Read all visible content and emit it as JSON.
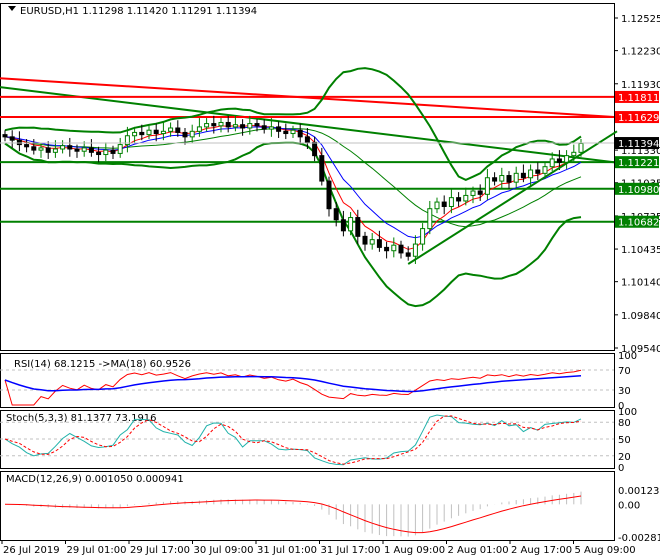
{
  "header": {
    "symbol": "EURUSD,H1",
    "ohlc": "1.11298 1.11420 1.11291 1.11394"
  },
  "chart_data": {
    "type": "candlestick",
    "title": "EURUSD,H1",
    "price_ticks": [
      "1.12525",
      "1.12230",
      "1.11930",
      "1.11330",
      "1.11035",
      "1.10735",
      "1.10435",
      "1.10140",
      "1.09840",
      "1.09540"
    ],
    "price_range": [
      1.0954,
      1.12525
    ],
    "closes": [
      1.1145,
      1.1142,
      1.1138,
      1.1136,
      1.1133,
      1.1135,
      1.1131,
      1.1134,
      1.1137,
      1.1134,
      1.1132,
      1.1135,
      1.1131,
      1.1129,
      1.1133,
      1.113,
      1.1138,
      1.1146,
      1.1149,
      1.1147,
      1.1151,
      1.1148,
      1.115,
      1.1153,
      1.1149,
      1.1145,
      1.115,
      1.1154,
      1.1157,
      1.1155,
      1.1158,
      1.1154,
      1.1156,
      1.1153,
      1.1157,
      1.1155,
      1.1152,
      1.1154,
      1.115,
      1.1148,
      1.1151,
      1.1145,
      1.114,
      1.1128,
      1.1105,
      1.108,
      1.107,
      1.106,
      1.1072,
      1.1055,
      1.1048,
      1.1052,
      1.1045,
      1.1042,
      1.1047,
      1.104,
      1.1037,
      1.1048,
      1.1062,
      1.108,
      1.1086,
      1.1082,
      1.109,
      1.1087,
      1.1092,
      1.1096,
      1.1093,
      1.1108,
      1.1105,
      1.111,
      1.1104,
      1.1112,
      1.1108,
      1.1115,
      1.1112,
      1.1118,
      1.1125,
      1.1122,
      1.1128,
      1.1131,
      1.1139
    ],
    "current_price": {
      "label": "1.11394",
      "value": 1.11394
    },
    "levels": [
      {
        "label": "1.11811",
        "value": 1.11811,
        "color": "#ff0000"
      },
      {
        "label": "1.11629",
        "value": 1.11629,
        "color": "#ff0000"
      },
      {
        "label": "1.11221",
        "value": 1.11221,
        "color": "#008000"
      },
      {
        "label": "1.10980",
        "value": 1.1098,
        "color": "#008000"
      },
      {
        "label": "1.10682",
        "value": 1.10682,
        "color": "#008000"
      }
    ],
    "slow_ma_red": [
      1.1198,
      1.1163
    ],
    "slow_ma_green": [
      1.119,
      1.1122
    ],
    "trendline": {
      "from_bar": 56,
      "from": 1.103,
      "to_bar": 85,
      "to": 1.115
    },
    "time_labels": [
      "26 Jul 2019",
      "29 Jul 01:00",
      "29 Jul 17:00",
      "30 Jul 09:00",
      "31 Jul 01:00",
      "31 Jul 17:00",
      "1 Aug 09:00",
      "2 Aug 01:00",
      "2 Aug 17:00",
      "5 Aug 09:00"
    ],
    "rsi": {
      "label": "RSI(14) 68.1215  ->MA(18) 60.9526",
      "ticks": [
        "100",
        "70",
        "30",
        "0"
      ]
    },
    "stoch": {
      "label": "Stoch(5,3,3) 81.1377 73.1916",
      "ticks": [
        "100",
        "80",
        "50",
        "20",
        "0"
      ]
    },
    "macd": {
      "label": "MACD(12,26,9) 0.001050 0.000941",
      "ticks": [
        "0.001235",
        "0.00",
        "-0.002817"
      ]
    },
    "colors": {
      "bull": "#008000",
      "bear": "#000000",
      "bands": "#008000",
      "ma_fast": "#ff0000",
      "ma_mid": "#0000ff",
      "rsi": "#ff0000",
      "rsi_ma": "#0000ff",
      "stoch_main": "#20b2aa",
      "stoch_signal": "#ff0000",
      "macd_hist": "#c0c0c0",
      "macd_signal": "#ff0000"
    }
  }
}
